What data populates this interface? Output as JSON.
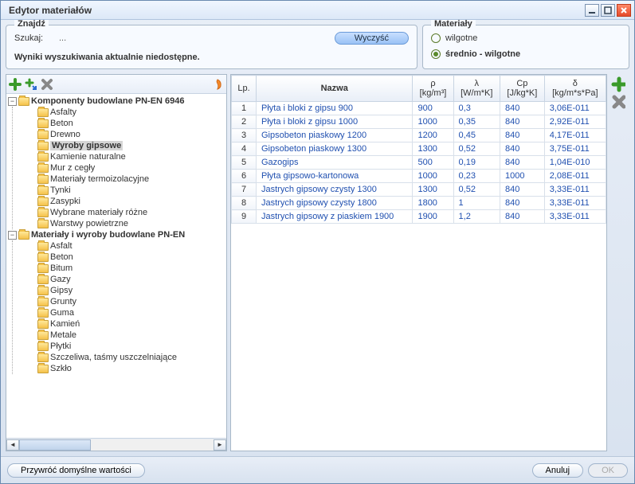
{
  "window": {
    "title": "Edytor materiałów"
  },
  "find": {
    "legend": "Znajdź",
    "search_label": "Szukaj:",
    "search_value": "...",
    "clear_label": "Wyczyść",
    "results_msg": "Wyniki wyszukiwania aktualnie niedostępne."
  },
  "materials_panel": {
    "legend": "Materiały",
    "option1": "wilgotne",
    "option2": "średnio - wilgotne",
    "selected": 2
  },
  "tree": {
    "root1": {
      "label": "Komponenty budowlane PN-EN 6946",
      "expanded": true,
      "children": [
        "Asfalty",
        "Beton",
        "Drewno",
        "Wyroby gipsowe",
        "Kamienie naturalne",
        "Mur z cegły",
        "Materiały termoizolacyjne",
        "Tynki",
        "Zasypki",
        "Wybrane materiały różne",
        "Warstwy powietrzne"
      ],
      "selected_child": "Wyroby gipsowe"
    },
    "root2": {
      "label": "Materiały i wyroby budowlane PN-EN",
      "expanded": true,
      "children": [
        "Asfalt",
        "Beton",
        "Bitum",
        "Gazy",
        "Gipsy",
        "Grunty",
        "Guma",
        "Kamień",
        "Metale",
        "Płytki",
        "Szczeliwa, taśmy uszczelniające",
        "Szkło"
      ]
    }
  },
  "grid": {
    "headers": {
      "lp": "Lp.",
      "name": "Nazwa",
      "rho": "ρ",
      "rho_u": "[kg/m³]",
      "lambda": "λ",
      "lambda_u": "[W/m*K]",
      "cp": "Cp",
      "cp_u": "[J/kg*K]",
      "delta": "δ",
      "delta_u": "[kg/m*s*Pa]"
    },
    "rows": [
      {
        "lp": "1",
        "name": "Płyta i bloki z gipsu 900",
        "rho": "900",
        "lambda": "0,3",
        "cp": "840",
        "delta": "3,06E-011"
      },
      {
        "lp": "2",
        "name": "Płyta i bloki z gipsu 1000",
        "rho": "1000",
        "lambda": "0,35",
        "cp": "840",
        "delta": "2,92E-011"
      },
      {
        "lp": "3",
        "name": "Gipsobeton piaskowy 1200",
        "rho": "1200",
        "lambda": "0,45",
        "cp": "840",
        "delta": "4,17E-011"
      },
      {
        "lp": "4",
        "name": "Gipsobeton piaskowy 1300",
        "rho": "1300",
        "lambda": "0,52",
        "cp": "840",
        "delta": "3,75E-011"
      },
      {
        "lp": "5",
        "name": "Gazogips",
        "rho": "500",
        "lambda": "0,19",
        "cp": "840",
        "delta": "1,04E-010"
      },
      {
        "lp": "6",
        "name": "Płyta gipsowo-kartonowa",
        "rho": "1000",
        "lambda": "0,23",
        "cp": "1000",
        "delta": "2,08E-011"
      },
      {
        "lp": "7",
        "name": "Jastrych gipsowy czysty 1300",
        "rho": "1300",
        "lambda": "0,52",
        "cp": "840",
        "delta": "3,33E-011"
      },
      {
        "lp": "8",
        "name": "Jastrych gipsowy czysty 1800",
        "rho": "1800",
        "lambda": "1",
        "cp": "840",
        "delta": "3,33E-011"
      },
      {
        "lp": "9",
        "name": "Jastrych gipsowy z piaskiem 1900",
        "rho": "1900",
        "lambda": "1,2",
        "cp": "840",
        "delta": "3,33E-011"
      }
    ]
  },
  "bottom": {
    "restore": "Przywróć domyślne wartości",
    "cancel": "Anuluj",
    "ok": "OK"
  }
}
